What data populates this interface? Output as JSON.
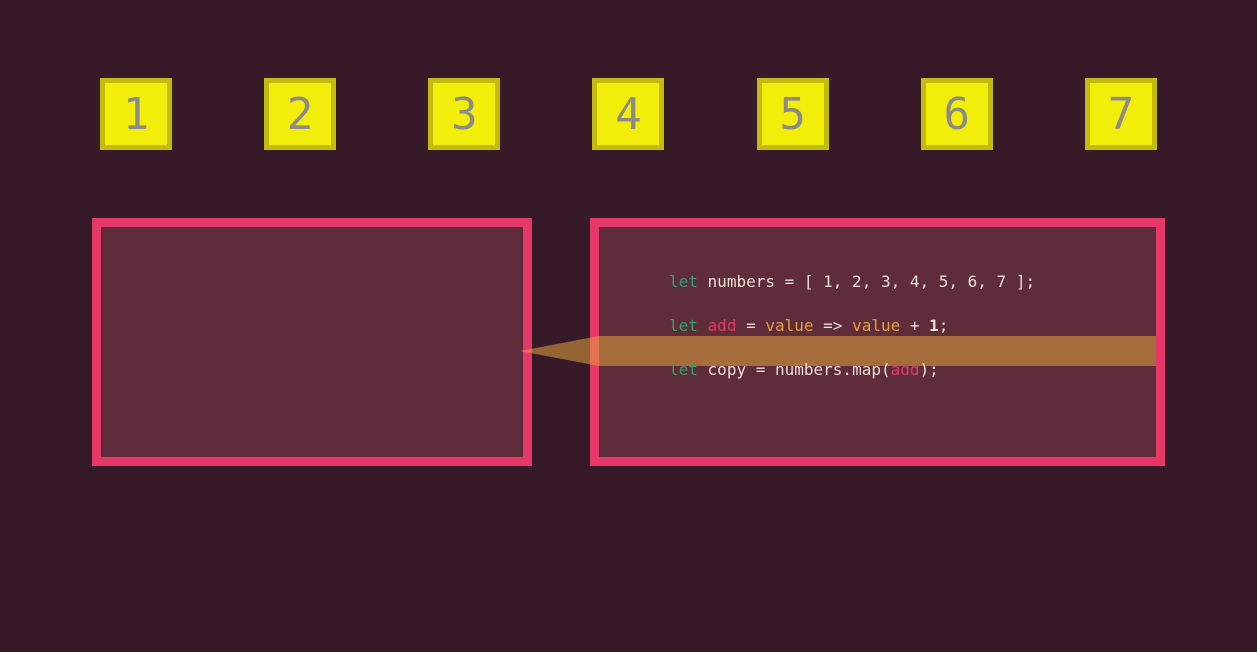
{
  "numbers": [
    "1",
    "2",
    "3",
    "4",
    "5",
    "6",
    "7"
  ],
  "code": {
    "line1": {
      "kw": "let",
      "id": "numbers",
      "eq": " = ",
      "arr": "[ 1, 2, 3, 4, 5, 6, 7 ]",
      "semi": ";"
    },
    "line2": {
      "kw": "let",
      "fn": "add",
      "eq": " = ",
      "param1": "value",
      "arrow": " => ",
      "param2": "value",
      "plus": " + ",
      "num": "1",
      "semi": ";"
    },
    "line3": {
      "kw": "let",
      "id": "copy",
      "eq": " = ",
      "obj": "numbers",
      "dot": ".",
      "method": "map",
      "open": "(",
      "arg": "add",
      "close": ")",
      "semi": ";"
    }
  },
  "colors": {
    "bg": "#361a28",
    "panel_bg": "#5f2c3c",
    "panel_border": "#e6396a",
    "box_fill": "#f3ed0a",
    "box_border": "#c3bb10",
    "box_text": "#8a8a8a",
    "highlight": "#e2a33a"
  }
}
